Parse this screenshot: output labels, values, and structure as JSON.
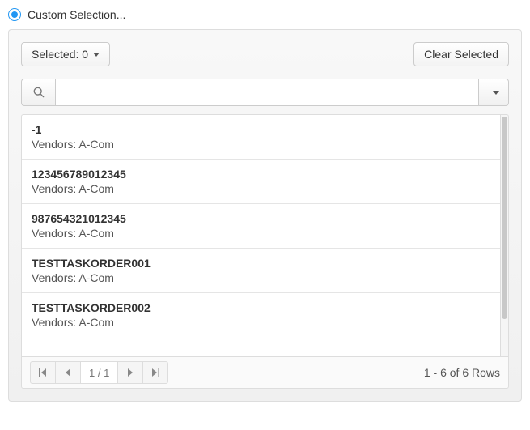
{
  "header": {
    "radio_label": "Custom Selection..."
  },
  "toolbar": {
    "selected_label": "Selected: 0",
    "clear_label": "Clear Selected"
  },
  "search": {
    "value": "",
    "placeholder": ""
  },
  "items": [
    {
      "title": "-1",
      "sub": "Vendors: A-Com"
    },
    {
      "title": "123456789012345",
      "sub": "Vendors: A-Com"
    },
    {
      "title": "987654321012345",
      "sub": "Vendors: A-Com"
    },
    {
      "title": "TESTTASKORDER001",
      "sub": "Vendors: A-Com"
    },
    {
      "title": "TESTTASKORDER002",
      "sub": "Vendors: A-Com"
    }
  ],
  "pager": {
    "page_label": "1 / 1",
    "rows_label": "1 - 6 of 6 Rows"
  }
}
